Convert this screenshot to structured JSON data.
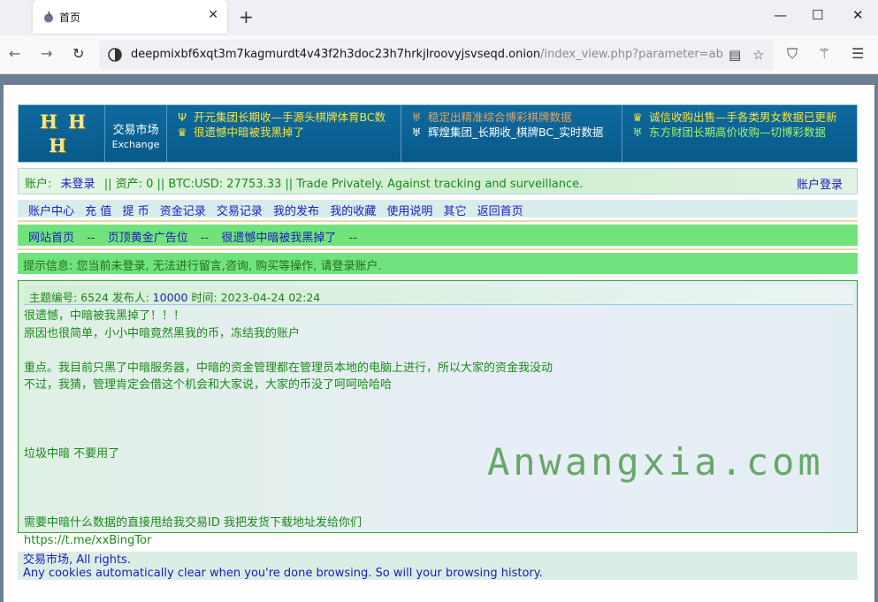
{
  "browser": {
    "tab_title": "首页",
    "new_tab_glyph": "+",
    "close_glyph": "✕",
    "url_host": "deepmixbf6xqt3m7kagmurdt4v43f2h3doc23h7hrkjlroovyjsvseqd.onion",
    "url_path": "/index_view.php?parameter=abdbEY",
    "icons": [
      "onion-icon",
      "back-icon",
      "forward-icon",
      "reload-icon",
      "reader-icon",
      "bookmark-star-icon",
      "shield-icon",
      "magic-wand-icon",
      "menu-icon"
    ]
  },
  "header": {
    "logo_glyphs": [
      "H",
      "H",
      "H"
    ],
    "brand_cn": "交易市场",
    "brand_en": "Exchange",
    "ads": [
      {
        "icon": "Ψ",
        "text": "开元集团长期收—手源头棋牌体育BC数",
        "color": "#f7e53b"
      },
      {
        "icon": "♛",
        "text": "很遗憾中暗被我黑掉了",
        "color": "#f7e53b"
      },
      {
        "icon": "♅",
        "text": "稳定出精准综合博彩棋牌数据",
        "color": "#d9a66a"
      },
      {
        "icon": "♅",
        "text": "辉煌集团_长期收_棋牌BC_实时数据",
        "color": "#ffffff"
      },
      {
        "icon": "♛",
        "text": "诚信收购出售—手各类男女数据已更新",
        "color": "#f7e53b"
      },
      {
        "icon": "♅",
        "text": "东方财团长期高价收购—切博彩数据",
        "color": "#a6f26b"
      }
    ]
  },
  "account": {
    "label": "账户:",
    "status": "未登录",
    "assets": "|| 资产: 0 || BTC:USD: 27753.33 || Trade Privately. Against tracking and surveillance.",
    "login": "账户登录"
  },
  "menu": [
    "账户中心",
    "充 值",
    "提 币",
    "资金记录",
    "交易记录",
    "我的发布",
    "我的收藏",
    "使用说明",
    "其它",
    "返回首页"
  ],
  "breadcrumb": {
    "items": [
      "网站首页",
      "页顶黄金广告位",
      "很遗憾中暗被我黑掉了"
    ],
    "sep": "--"
  },
  "notice": "提示信息: 您当前未登录, 无法进行留言,咨询, 购买等操作, 请登录账户.",
  "post": {
    "topic_label": "主题编号: 6524 发布人:",
    "author": "10000",
    "time": "时间: 2023-04-24 02:24",
    "lines": [
      "很遗憾，中暗被我黑掉了！！！",
      "原因也很简单，小小中暗竟然黑我的币，冻结我的账户",
      "",
      "重点。我目前只黑了中暗服务器，中暗的资金管理都在管理员本地的电脑上进行，所以大家的资金我没动",
      "不过，我猜，管理肯定会借这个机会和大家说，大家的币没了呵呵哈哈哈",
      "",
      "",
      "",
      "垃圾中暗 不要用了",
      "",
      "",
      "",
      "需要中暗什么数据的直接甩给我交易ID 我把发货下载地址发给你们",
      "https://t.me/xxBingTor"
    ],
    "watermark": "Anwangxia.com"
  },
  "footer": {
    "line1": "交易市场, All rights.",
    "line2": "Any cookies automatically clear when you're done browsing. So will your browsing history."
  }
}
